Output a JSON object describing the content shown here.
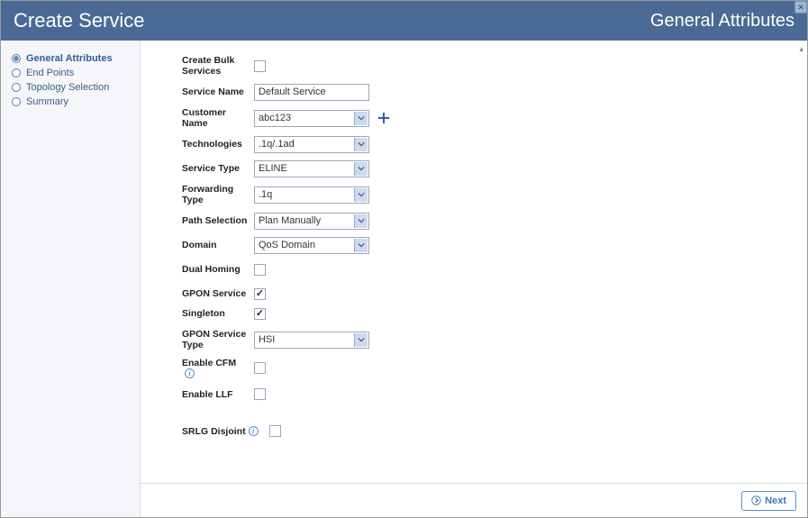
{
  "window": {
    "title_left": "Create Service",
    "title_right": "General Attributes"
  },
  "wizard_steps": [
    {
      "label": "General Attributes",
      "active": true
    },
    {
      "label": "End Points",
      "active": false
    },
    {
      "label": "Topology Selection",
      "active": false
    },
    {
      "label": "Summary",
      "active": false
    }
  ],
  "form": {
    "create_bulk_services": {
      "label": "Create Bulk Services",
      "checked": false
    },
    "service_name": {
      "label": "Service Name",
      "value": "Default Service"
    },
    "customer_name": {
      "label": "Customer Name",
      "value": "abc123"
    },
    "technologies": {
      "label": "Technologies",
      "value": ".1q/.1ad"
    },
    "service_type": {
      "label": "Service Type",
      "value": "ELINE"
    },
    "forwarding_type": {
      "label": "Forwarding Type",
      "value": ".1q"
    },
    "path_selection": {
      "label": "Path Selection",
      "value": "Plan Manually"
    },
    "domain": {
      "label": "Domain",
      "value": "QoS Domain"
    },
    "dual_homing": {
      "label": "Dual Homing",
      "checked": false
    },
    "gpon_service": {
      "label": "GPON Service",
      "checked": true
    },
    "singleton": {
      "label": "Singleton",
      "checked": true
    },
    "gpon_service_type": {
      "label": "GPON Service Type",
      "value": "HSI"
    },
    "enable_cfm": {
      "label": "Enable CFM",
      "checked": false
    },
    "enable_llf": {
      "label": "Enable LLF",
      "checked": false
    },
    "srlg_disjoint": {
      "label": "SRLG Disjoint",
      "checked": false
    }
  },
  "footer": {
    "next_label": "Next"
  }
}
